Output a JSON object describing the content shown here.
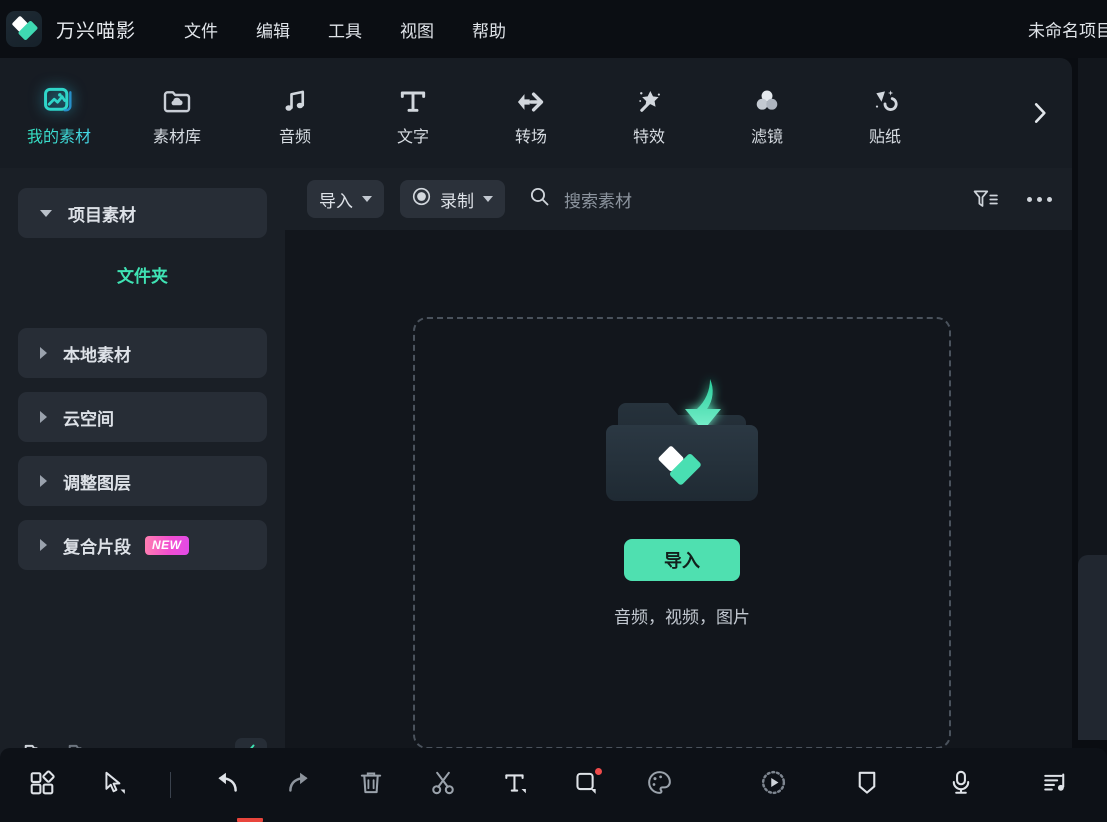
{
  "titlebar": {
    "app_name": "万兴喵影",
    "logo_icon": "filmora-logo-icon",
    "menus": [
      {
        "label": "文件"
      },
      {
        "label": "编辑"
      },
      {
        "label": "工具"
      },
      {
        "label": "视图"
      },
      {
        "label": "帮助"
      }
    ],
    "project_title": "未命名项目"
  },
  "tabs": [
    {
      "label": "我的素材",
      "icon": "image-media-icon",
      "active": true
    },
    {
      "label": "素材库",
      "icon": "folder-cloud-icon",
      "active": false
    },
    {
      "label": "音频",
      "icon": "music-note-icon",
      "active": false
    },
    {
      "label": "文字",
      "icon": "text-t-icon",
      "active": false
    },
    {
      "label": "转场",
      "icon": "transition-arrows-icon",
      "active": false
    },
    {
      "label": "特效",
      "icon": "magic-wand-star-icon",
      "active": false
    },
    {
      "label": "滤镜",
      "icon": "color-circles-icon",
      "active": false
    },
    {
      "label": "贴纸",
      "icon": "sticker-shapes-icon",
      "active": false
    }
  ],
  "tabs_next_label": "›",
  "sidebar": {
    "items": [
      {
        "label": "项目素材",
        "state": "expanded",
        "style": "card"
      },
      {
        "label": "文件夹",
        "state": "selected",
        "style": "plain"
      },
      {
        "label": "本地素材",
        "state": "collapsed",
        "style": "card"
      },
      {
        "label": "云空间",
        "state": "collapsed",
        "style": "card"
      },
      {
        "label": "调整图层",
        "state": "collapsed",
        "style": "card"
      },
      {
        "label": "复合片段",
        "state": "collapsed",
        "style": "card",
        "badge": "NEW"
      }
    ],
    "footer": {
      "new_folder_icon": "folder-add-icon",
      "delete_folder_icon": "folder-delete-icon",
      "collapse_icon": "chevron-left-icon"
    },
    "accent_color": "#3fe3b4",
    "badge_color": "#f24fd0"
  },
  "content": {
    "toolbar": {
      "import_label": "导入",
      "import_caret_icon": "chevron-down-icon",
      "record_label": "录制",
      "record_icon": "record-circle-icon",
      "record_caret_icon": "chevron-down-icon",
      "search_icon": "search-icon",
      "search_placeholder": "搜索素材",
      "filter_icon": "filter-funnel-icon",
      "more_icon": "more-options-icon"
    },
    "dropzone": {
      "art_icon": "folder-import-arrow-icon",
      "import_button": "导入",
      "hint": "音频，视频，图片",
      "button_color": "#4fe0b0"
    }
  },
  "bottom_toolbar": {
    "left_tools": [
      {
        "icon": "grid-layout-icon",
        "name": "layout-button"
      },
      {
        "icon": "cursor-select-icon",
        "name": "select-tool-button"
      }
    ],
    "edit_tools": [
      {
        "icon": "undo-arrow-icon",
        "name": "undo-button"
      },
      {
        "icon": "redo-arrow-icon",
        "name": "redo-button"
      },
      {
        "icon": "trash-bin-icon",
        "name": "delete-button"
      },
      {
        "icon": "scissors-icon",
        "name": "split-button"
      },
      {
        "icon": "text-tool-icon",
        "name": "text-tool-button"
      },
      {
        "icon": "shape-crop-icon",
        "name": "shape-tool-button",
        "badge": true
      },
      {
        "icon": "color-palette-icon",
        "name": "color-tool-button"
      }
    ],
    "right_tools": [
      {
        "icon": "render-preview-icon",
        "name": "render-preview-button"
      },
      {
        "icon": "marker-tag-icon",
        "name": "marker-button"
      },
      {
        "icon": "microphone-icon",
        "name": "voiceover-button"
      },
      {
        "icon": "audio-list-icon",
        "name": "audio-mixer-button"
      }
    ]
  }
}
